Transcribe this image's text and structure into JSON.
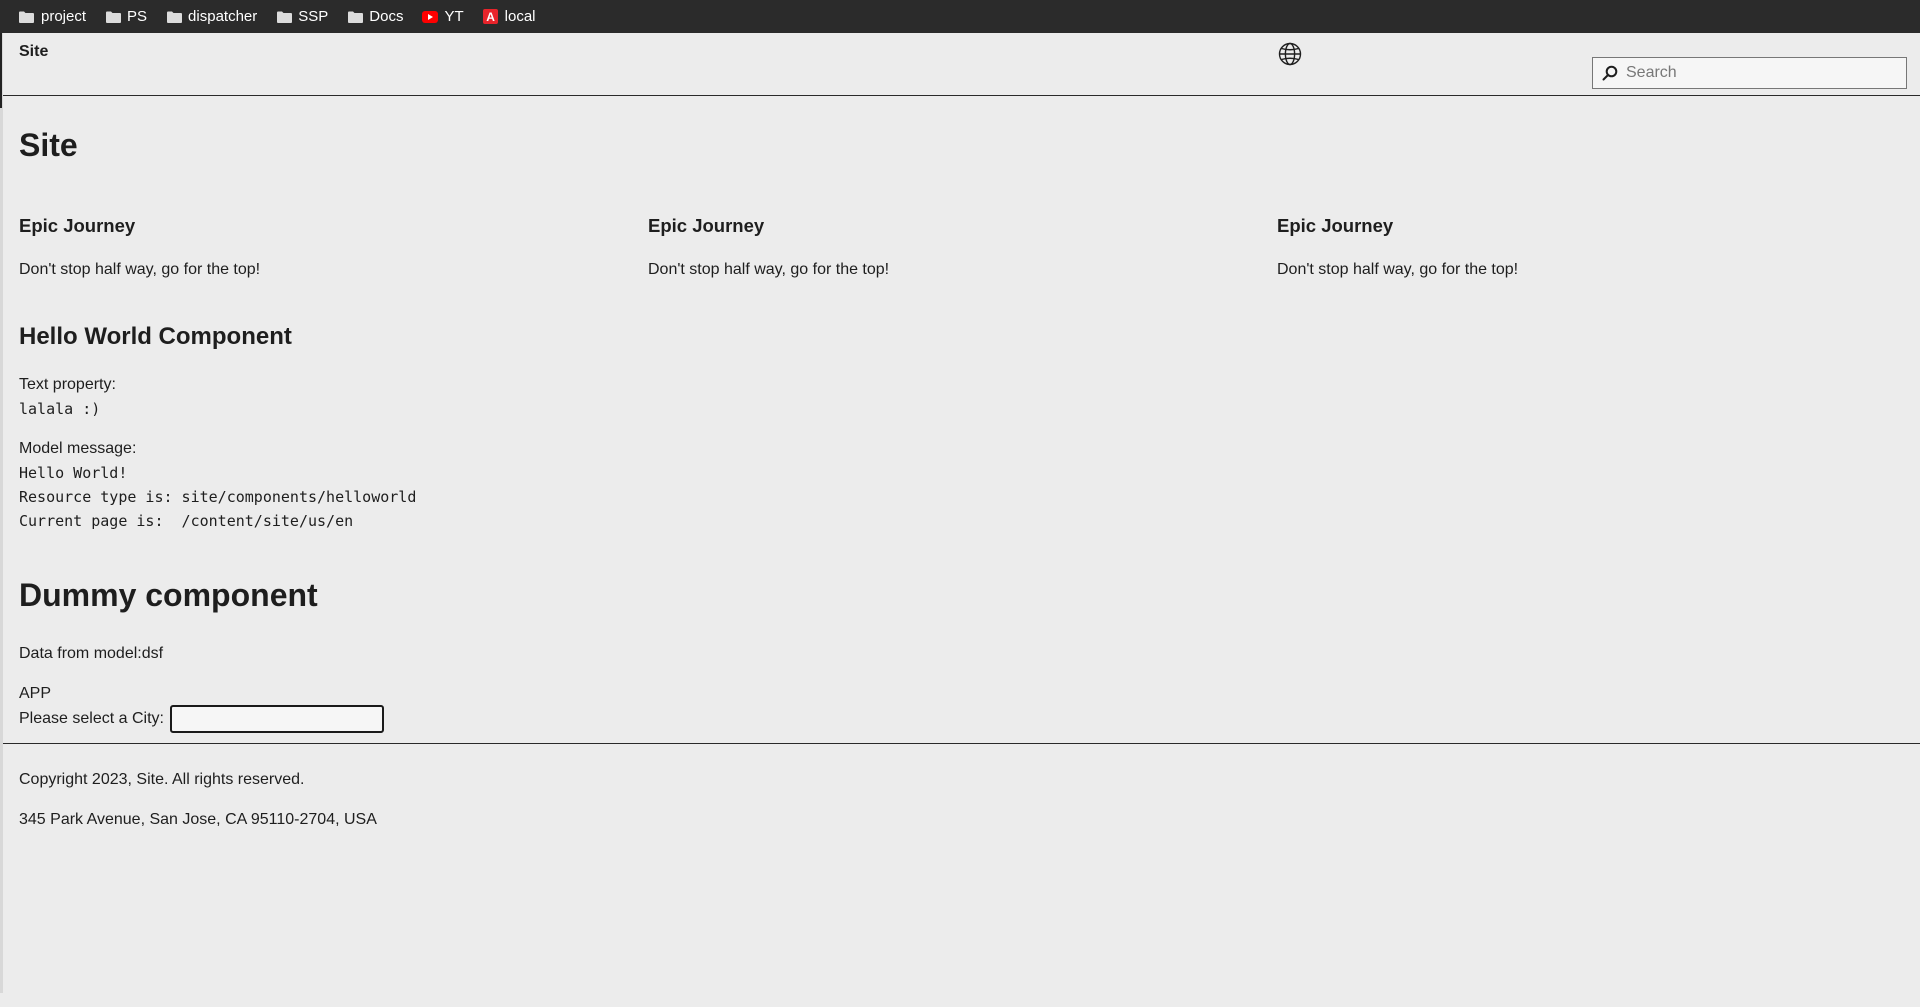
{
  "bookmarks": [
    {
      "label": "project",
      "icon": "folder-icon"
    },
    {
      "label": "PS",
      "icon": "folder-icon"
    },
    {
      "label": "dispatcher",
      "icon": "folder-icon"
    },
    {
      "label": "SSP",
      "icon": "folder-icon"
    },
    {
      "label": "Docs",
      "icon": "folder-icon"
    },
    {
      "label": "YT",
      "icon": "youtube-icon"
    },
    {
      "label": "local",
      "icon": "adobe-icon",
      "icon_letter": "A"
    }
  ],
  "header": {
    "brand": "Site",
    "language_icon": "globe-icon",
    "search": {
      "placeholder": "Search",
      "value": ""
    }
  },
  "main": {
    "page_title": "Site",
    "teasers": [
      {
        "title": "Epic Journey",
        "description": "Don't stop half way, go for the top!"
      },
      {
        "title": "Epic Journey",
        "description": "Don't stop half way, go for the top!"
      },
      {
        "title": "Epic Journey",
        "description": "Don't stop half way, go for the top!"
      }
    ],
    "hello_world": {
      "title": "Hello World Component",
      "text_property_label": "Text property:",
      "text_property_value": "lalala :)",
      "model_message_label": "Model message:",
      "model_lines": [
        "Hello World!",
        "Resource type is: site/components/helloworld",
        "Current page is:  /content/site/us/en"
      ]
    },
    "dummy": {
      "title": "Dummy component",
      "data_text": "Data from model:dsf",
      "app_label": "APP",
      "city_label": "Please select a City:",
      "city_value": ""
    }
  },
  "footer": {
    "copyright": "Copyright 2023, Site. All rights reserved.",
    "address": "345 Park Avenue, San Jose, CA 95110-2704, USA"
  },
  "colors": {
    "bookmarks_bar_bg": "#2b2b2b",
    "page_bg": "#ececec",
    "text": "#1e1e1e",
    "youtube_red": "#ff0000",
    "adobe_red": "#e8242b"
  }
}
